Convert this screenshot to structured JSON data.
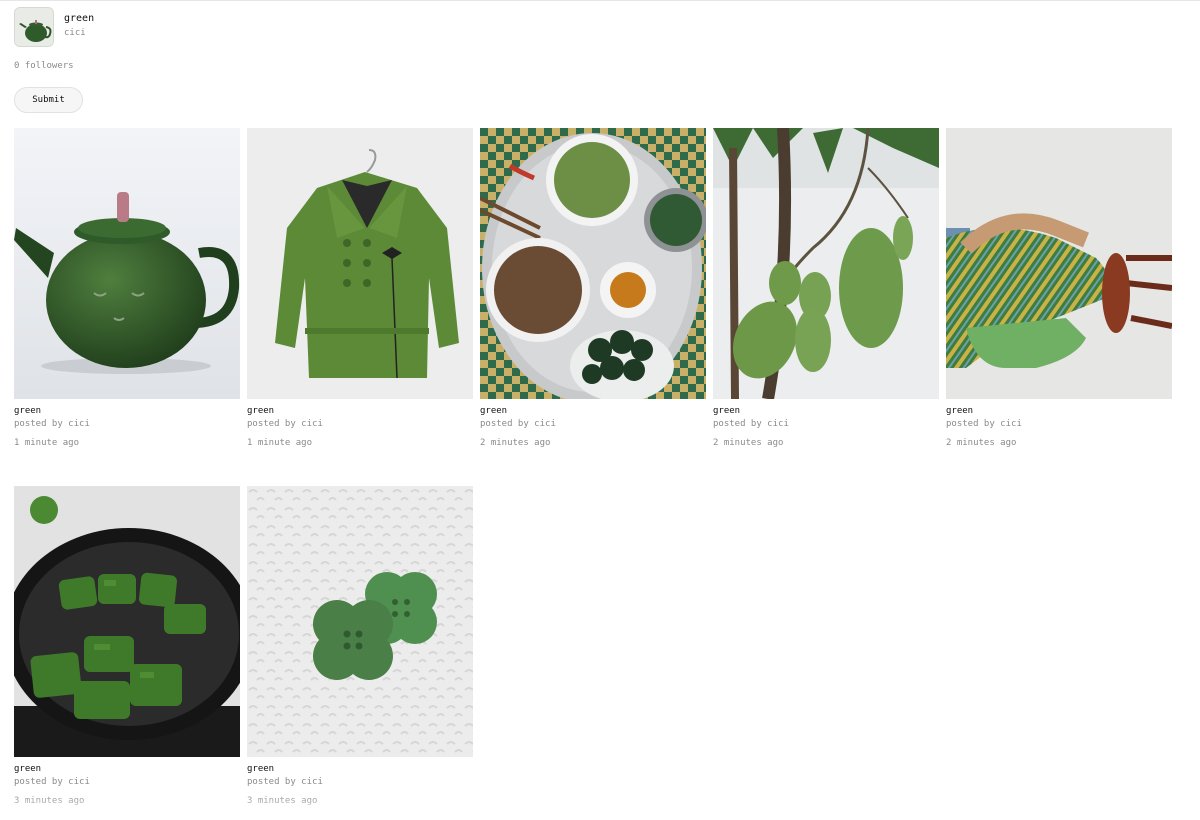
{
  "profile": {
    "name": "green",
    "username": "cici",
    "followers": "0 followers",
    "avatar_icon": "teapot-thumbnail"
  },
  "submit_label": "Submit",
  "posts": [
    {
      "title": "green",
      "by": "posted by cici",
      "ago": "1 minute ago",
      "image": "green-teapot"
    },
    {
      "title": "green",
      "by": "posted by cici",
      "ago": "1 minute ago",
      "image": "green-jacket"
    },
    {
      "title": "green",
      "by": "posted by cici",
      "ago": "2 minutes ago",
      "image": "food-platter"
    },
    {
      "title": "green",
      "by": "posted by cici",
      "ago": "2 minutes ago",
      "image": "green-mangoes"
    },
    {
      "title": "green",
      "by": "posted by cici",
      "ago": "2 minutes ago",
      "image": "striped-legs-stool"
    },
    {
      "title": "green",
      "by": "posted by cici",
      "ago": "3 minutes ago",
      "image": "wrapped-leaves-pan"
    },
    {
      "title": "green",
      "by": "posted by cici",
      "ago": "3 minutes ago",
      "image": "green-flower-buttons"
    }
  ]
}
